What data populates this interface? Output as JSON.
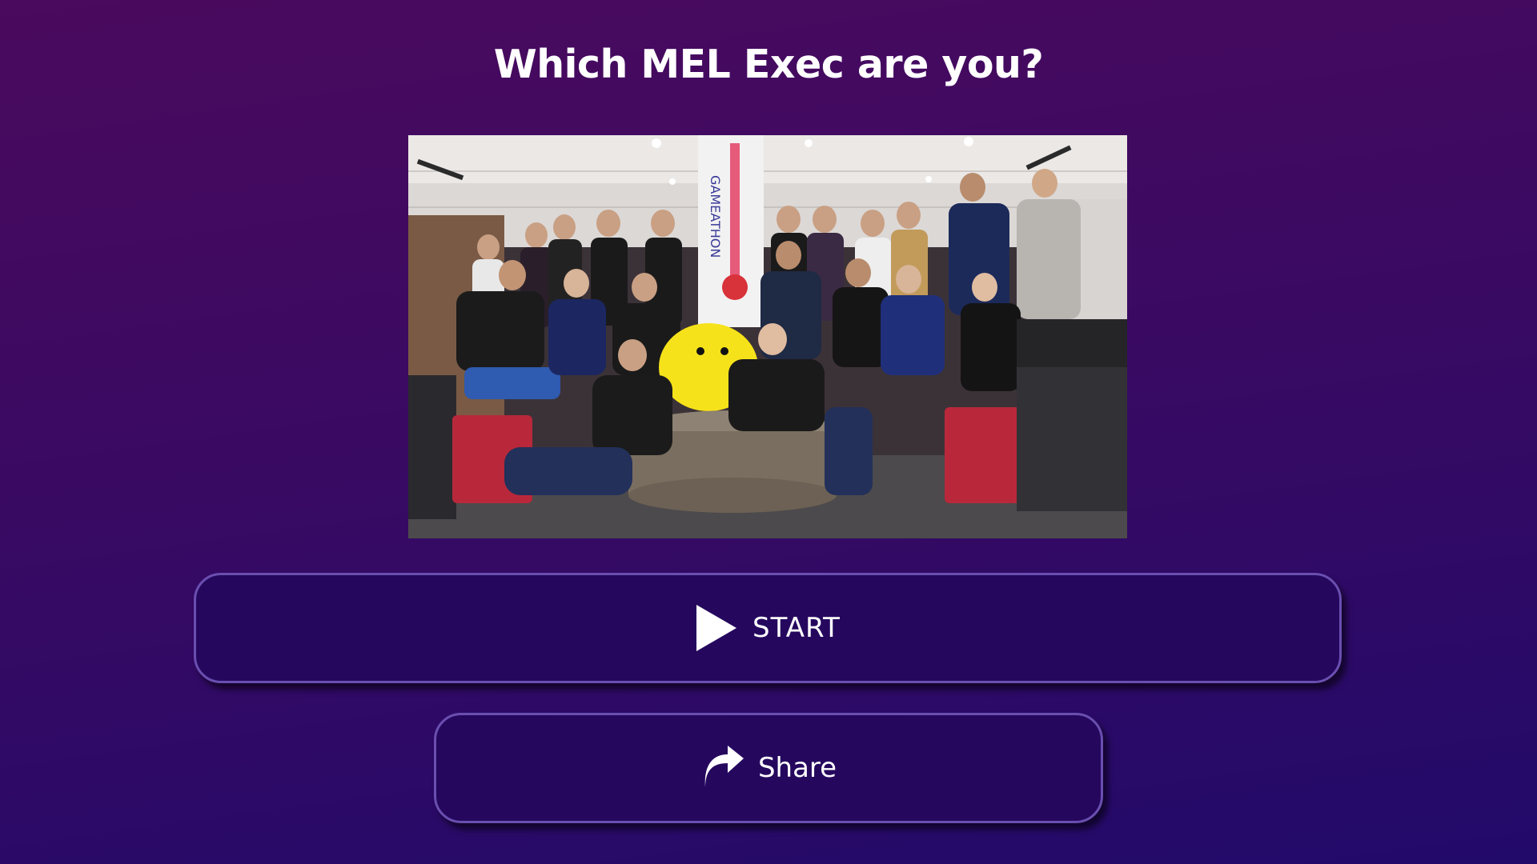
{
  "page": {
    "title": "Which MEL Exec are you?"
  },
  "photo": {
    "banner_text": "GAMEATHON",
    "icon": "group-photo"
  },
  "buttons": {
    "start_label": "START",
    "start_icon": "play-icon",
    "share_label": "Share",
    "share_icon": "share-arrow-icon"
  },
  "colors": {
    "background_top": "#4a0a5e",
    "background_bottom": "#220a6a",
    "button_fill": "#25085e",
    "button_border": "#6a4fb0"
  }
}
